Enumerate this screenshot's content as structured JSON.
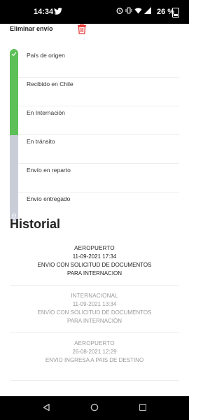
{
  "status_bar": {
    "time": "14:34",
    "battery": "26 %",
    "icons": [
      "twitter-icon",
      "alarm-icon",
      "vibrate-icon",
      "wifi-icon",
      "signal-icon",
      "battery-icon"
    ]
  },
  "header": {
    "delete_label": "Eliminar envío",
    "delete_icon": "trash-icon",
    "accent_color": "#e53935"
  },
  "timeline": {
    "done_color": "#5cbf57",
    "pending_color": "#c9cdd8",
    "steps": [
      {
        "label": "País de origen",
        "status": "done"
      },
      {
        "label": "Recibido en Chile",
        "status": "done"
      },
      {
        "label": "En Internación",
        "status": "done"
      },
      {
        "label": "En tránsito",
        "status": "pending"
      },
      {
        "label": "Envío en reparto",
        "status": "pending"
      },
      {
        "label": "Envío entregado",
        "status": "pending"
      }
    ]
  },
  "history": {
    "title": "Historial",
    "events": [
      {
        "location": "AEROPUERTO",
        "datetime": "11-09-2021 17:34",
        "desc1": "ENVIO CON SOLICITUD DE DOCUMENTOS",
        "desc2": "PARA INTERNACION"
      },
      {
        "location": "INTERNACIONAL",
        "datetime": "11-09-2021 13:34",
        "desc1": "ENVÍO CON SOLICITUD DE DOCUMENTOS",
        "desc2": "PARA INTERNACIÓN"
      },
      {
        "location": "AEROPUERTO",
        "datetime": "26-08-2021 12:29",
        "desc1": "ENVIO INGRESA A PAIS DE DESTINO",
        "desc2": ""
      }
    ]
  },
  "nav": {
    "back_icon": "back-triangle-icon",
    "home_icon": "home-circle-icon",
    "recents_icon": "recents-square-icon"
  }
}
